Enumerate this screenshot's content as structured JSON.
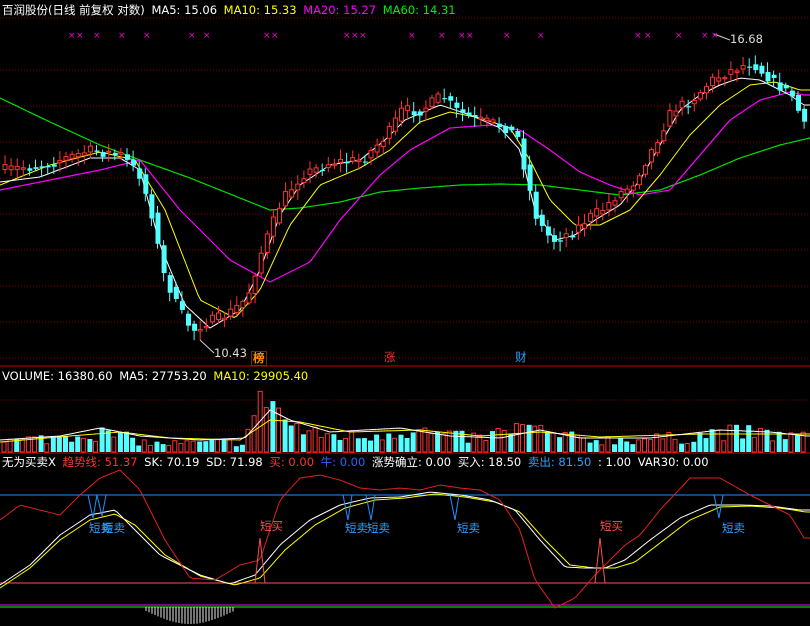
{
  "colors": {
    "bg": "#000000",
    "up": "#ff3232",
    "down": "#54ffff",
    "ma5": "#ffffff",
    "ma10": "#ffff00",
    "ma20": "#ff00ff",
    "ma60": "#00e000",
    "separator": "#c80000",
    "grid": "#8b0000",
    "blue_line": "#1e90ff",
    "buy": "#ff5050",
    "sell": "#29a3ff"
  },
  "price_panel": {
    "title": "百润股份(日线 前复权 对数)",
    "legend": [
      {
        "label": "MA5: 15.06",
        "color": "#ffffff"
      },
      {
        "label": "MA10: 15.33",
        "color": "#ffff00"
      },
      {
        "label": "MA20: 15.27",
        "color": "#ff00ff"
      },
      {
        "label": "MA60: 14.31",
        "color": "#00e000"
      }
    ],
    "high_label": "16.68",
    "low_label": "10.43",
    "event_tags": [
      {
        "text": "榜",
        "color": "#ff8c00"
      },
      {
        "text": "涨",
        "color": "#ff3232"
      },
      {
        "text": "财",
        "color": "#29a3ff"
      }
    ],
    "marker_glyph": "×"
  },
  "volume_panel": {
    "legend": [
      {
        "label": "VOLUME: 16380.60",
        "color": "#ffffff"
      },
      {
        "label": "MA5: 27753.20",
        "color": "#ffffff"
      },
      {
        "label": "MA10: 29905.40",
        "color": "#ffff00"
      }
    ]
  },
  "indicator_panel": {
    "legend": [
      {
        "label": "无为买卖X",
        "color": "#ffffff"
      },
      {
        "label": "趋势线: 51.37",
        "color": "#ff3232"
      },
      {
        "label": "SK: 70.19",
        "color": "#ffffff"
      },
      {
        "label": "SD: 71.98",
        "color": "#ffffff"
      },
      {
        "label": "买: 0.00",
        "color": "#ff3232"
      },
      {
        "label": "牛: 0.00",
        "color": "#3060ff"
      },
      {
        "label": "涨势确立: 0.00",
        "color": "#ffffff"
      },
      {
        "label": "买入: 18.50",
        "color": "#ffffff"
      },
      {
        "label": "卖出: 81.50",
        "color": "#29a3ff"
      },
      {
        "label": ": 1.00",
        "color": "#ffffff"
      },
      {
        "label": "VAR30: 0.00",
        "color": "#ffffff"
      }
    ],
    "signal_labels": {
      "sell": "短卖",
      "buy": "短买"
    },
    "buy_level": 18.5,
    "sell_level": 81.5
  },
  "chart_data": [
    {
      "type": "candlestick",
      "title": "百润股份(日线 前复权 对数)",
      "scale": "log",
      "y_range": [
        10.43,
        16.68
      ],
      "visible_high": 16.68,
      "visible_low": 10.43,
      "series": [
        {
          "name": "MA5",
          "last": 15.06
        },
        {
          "name": "MA10",
          "last": 15.33
        },
        {
          "name": "MA20",
          "last": 15.27
        },
        {
          "name": "MA60",
          "last": 14.31
        }
      ],
      "grid": true
    },
    {
      "type": "bar",
      "series": [
        {
          "name": "VOLUME",
          "last": 16380.6
        },
        {
          "name": "MA5",
          "last": 27753.2
        },
        {
          "name": "MA10",
          "last": 29905.4
        }
      ]
    },
    {
      "type": "line",
      "title": "无为买卖X",
      "y_range": [
        0,
        100
      ],
      "series": [
        {
          "name": "趋势线",
          "last": 51.37
        },
        {
          "name": "SK",
          "last": 70.19
        },
        {
          "name": "SD",
          "last": 71.98
        }
      ],
      "levels": {
        "买入": 18.5,
        "卖出": 81.5
      }
    }
  ]
}
